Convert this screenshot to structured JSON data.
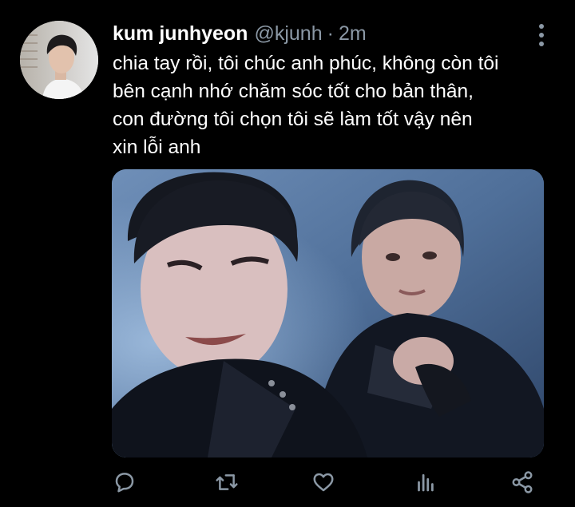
{
  "tweet": {
    "author_name": "kum junhyeon",
    "author_handle": "@kjunh",
    "separator": "·",
    "timestamp": "2m",
    "text_lines": [
      "chia tay rồi, tôi chúc anh phúc, không còn tôi",
      "bên cạnh nhớ chăm sóc tốt cho bản thân,",
      "con đường tôi chọn tôi sẽ làm tốt vậy nên",
      "xin lỗi anh"
    ]
  },
  "icons": {
    "more": "more-vertical-icon",
    "reply": "reply-icon",
    "retweet": "retweet-icon",
    "like": "heart-icon",
    "analytics": "analytics-icon",
    "share": "share-icon"
  },
  "colors": {
    "background": "#000000",
    "text": "#ffffff",
    "secondary_text": "#8b98a5",
    "icon": "#8b98a5"
  }
}
